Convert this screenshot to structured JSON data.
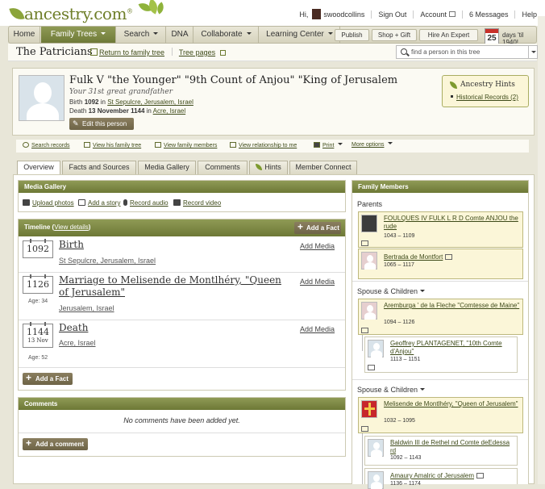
{
  "app": {
    "logo": "ancestry",
    "logo_suffix": ".com"
  },
  "toplinks": {
    "greeting": "Hi,",
    "username": "swoodcollins",
    "sign_out": "Sign Out",
    "account": "Account",
    "messages": "6 Messages",
    "help": "Help"
  },
  "nav": {
    "items": [
      "Home",
      "Family Trees",
      "Search",
      "DNA",
      "Collaborate",
      "Learning Center"
    ],
    "publish": "Publish",
    "shop": "Shop + Gift",
    "hire": "Hire An Expert",
    "days_num": "25",
    "days_text": "days 'til 1940!"
  },
  "tree": {
    "name": "The Patricians",
    "return_link": "Return to family tree",
    "pages_link": "Tree pages",
    "search_placeholder": "find a person in this tree"
  },
  "person": {
    "name": "Fulk V \"the Younger\" \"9th Count of Anjou\" \"King of Jerusalem",
    "relation": "Your 31st great grandfather",
    "birth_label": "Birth",
    "birth_year": "1092",
    "birth_in": "in",
    "birth_place": "St Sepulcre, Jerusalem, Israel",
    "death_label": "Death",
    "death_date": "13 November 1144",
    "death_in": "in",
    "death_place": "Acre, Israel",
    "edit_button": "Edit this person"
  },
  "hints": {
    "title": "Ancestry Hints",
    "records": "Historical Records (2)"
  },
  "actions": [
    "Search records",
    "View his family tree",
    "View family members",
    "View relationship to me",
    "Print",
    "More options"
  ],
  "tabs": [
    "Overview",
    "Facts and Sources",
    "Media Gallery",
    "Comments",
    "Hints",
    "Member Connect"
  ],
  "media": {
    "title": "Media Gallery",
    "upload": "Upload photos",
    "story": "Add a story",
    "audio": "Record audio",
    "video": "Record video"
  },
  "timeline": {
    "title": "Timeline (",
    "details": "View details",
    "close": ")",
    "add_fact": "Add a Fact",
    "add_media": "Add Media",
    "events": [
      {
        "year": "1092",
        "sub": "",
        "age": "",
        "title": "Birth",
        "place": "St Sepulcre, Jerusalem, Israel"
      },
      {
        "year": "1126",
        "sub": "",
        "age": "Age: 34",
        "title": "Marriage to Melisende de Montlhéry, \"Queen of Jerusalem\"",
        "place": "Jerusalem, Israel"
      },
      {
        "year": "1144",
        "sub": "13 Nov",
        "age": "Age: 52",
        "title": "Death",
        "place": "Acre, Israel"
      }
    ]
  },
  "comments": {
    "title": "Comments",
    "empty": "No comments have been added yet.",
    "add": "Add a comment"
  },
  "family": {
    "title": "Family Members",
    "parents_label": "Parents",
    "spouse1_label": "Spouse & Children",
    "spouse2_label": "Spouse & Children",
    "parents": [
      {
        "name": "FOULQUES IV FULK L R D Comte ANJOU the rude",
        "dates": "1043 – 1109"
      },
      {
        "name": "Bertrada de Montfort",
        "dates": "1065 – 1117"
      }
    ],
    "spouse1": {
      "name": "Aremburga ' de la Fleche \"Comtesse de Maine\"",
      "dates": "1094 – 1126"
    },
    "child1": {
      "name": "Geoffrey PLANTAGENET, \"10th Comte d'Anjou\"",
      "dates": "1113 – 1151"
    },
    "spouse2": {
      "name": "Melisende de Montlhéry, \"Queen of Jerusalem\"",
      "dates": "1032 – 1095"
    },
    "child2": {
      "name": "Baldwin III de Rethel nd Comte deEdessa rd",
      "dates": "1092 – 1143"
    },
    "child3": {
      "name": "Amaury Amalric of Jerusalem",
      "dates": "1136 – 1174"
    }
  },
  "colors": {
    "panel_header": "#7d8845",
    "hint_bg": "#fbf6d8",
    "link": "#3d4a18",
    "brand": "#6f7f2a"
  }
}
